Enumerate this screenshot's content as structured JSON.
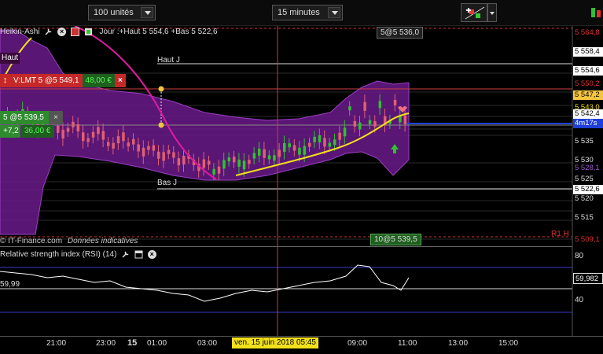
{
  "toolbar": {
    "units_value": "100 unités",
    "interval_value": "15 minutes"
  },
  "chart": {
    "instrument": "Heikin-Ashi",
    "info": "Jour :+Haut 5 554,6 +Bas 5 522,6",
    "cursor_price_tag": "5@5 536,0",
    "haut_j_label": "Haut J",
    "bas_j_label": "Bas J",
    "top_left_label": "Haut",
    "order_label": "V:LMT  5 @5 549,1",
    "order_pl": "48,00 €",
    "position_label": "5 @5 539,5",
    "position_change": "+7,2",
    "position_pl": "36,00 €",
    "credit": "© IT-Finance.com",
    "credit_note": "Données indicatives",
    "bottom_tag": "10@5 539,5",
    "r1_label": "R1 H",
    "countdown": "4m17s",
    "price_labels": [
      "5 564,8",
      "5 558,4",
      "5 554,6",
      "5 550,2",
      "5 547,2",
      "5 543,0",
      "5 542,4",
      "5 535",
      "5 530",
      "5 528,1",
      "5 525",
      "5 522,6",
      "5 520",
      "5 515",
      "5 509,1"
    ],
    "colors": {
      "up": "#2fc22f",
      "down": "#e06070",
      "band_fill": "#6a1a8a",
      "band_edge": "#9b3fc4",
      "ma_yellow": "#f2e01a",
      "ma_magenta": "#e01aa0",
      "current_blue": "#1f3fd6",
      "resistance_red": "#e03030"
    }
  },
  "rsi": {
    "title": "Relative strength index (RSI) (14)",
    "left_value": "59,99",
    "current_value": "59,982",
    "level_80": "80",
    "level_40": "40"
  },
  "time_axis": {
    "labels": [
      "21:00",
      "23:00",
      "15",
      "01:00",
      "03:00",
      "09:00",
      "11:00",
      "13:00",
      "15:00"
    ],
    "cursor_date": "ven. 15 juin 2018 05:45"
  }
}
